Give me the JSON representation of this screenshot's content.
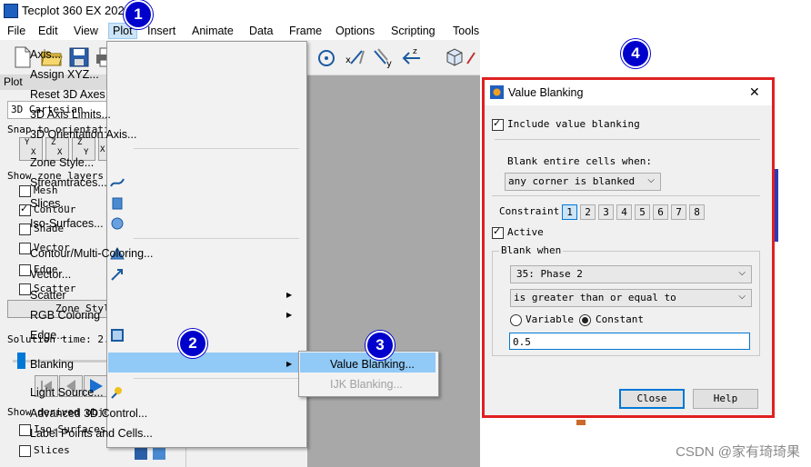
{
  "app": {
    "title": "Tecplot 360 EX 202"
  },
  "menubar": [
    "File",
    "Edit",
    "View",
    "Plot",
    "Insert",
    "Animate",
    "Data",
    "Frame",
    "Options",
    "Scripting",
    "Tools"
  ],
  "sidebar": {
    "header": "Plot",
    "plot_type": "3D Cartesian",
    "snap_label": "Snap to orientation",
    "snap_buttons": [
      {
        "top": "Y",
        "bottom": "X"
      },
      {
        "top": "Z",
        "bottom": "X"
      },
      {
        "top": "Z",
        "bottom": "Y"
      },
      {
        "top": "X",
        "bottom": ""
      }
    ],
    "zone_layers_label": "Show zone layers",
    "layers": [
      {
        "label": "Mesh",
        "checked": false
      },
      {
        "label": "Contour",
        "checked": true
      },
      {
        "label": "Shade",
        "checked": false
      },
      {
        "label": "Vector",
        "checked": false
      },
      {
        "label": "Edge",
        "checked": false
      },
      {
        "label": "Scatter",
        "checked": false
      }
    ],
    "zone_style_button": "Zone Styl",
    "solution_time": "Solution time: 2.00",
    "derived_label": "Show derived objec",
    "derived": [
      {
        "label": "Iso-Surfaces",
        "checked": false
      },
      {
        "label": "Slices",
        "checked": false
      }
    ]
  },
  "plot_menu": {
    "items": [
      {
        "label": "Axis..."
      },
      {
        "label": "Assign XYZ..."
      },
      {
        "label": "Reset 3D Axes"
      },
      {
        "label": "3D Axis Limits..."
      },
      {
        "label": "3D Orientation Axis..."
      },
      {
        "label": "Zone Style..."
      },
      {
        "label": "Streamtraces...",
        "icon": "streamtrace-icon"
      },
      {
        "label": "Slices...",
        "icon": "slice-icon"
      },
      {
        "label": "Iso-Surfaces...",
        "icon": "iso-surface-icon"
      },
      {
        "label": "Contour/Multi-Coloring...",
        "icon": "contour-icon"
      },
      {
        "label": "Vector...",
        "icon": "vector-icon"
      },
      {
        "label": "Scatter",
        "submenu": true
      },
      {
        "label": "RGB Coloring",
        "submenu": true
      },
      {
        "label": "Edge...",
        "icon": "edge-icon"
      },
      {
        "label": "Blanking",
        "submenu": true,
        "highlighted": true
      },
      {
        "label": "Light Source...",
        "icon": "light-source-icon"
      },
      {
        "label": "Advanced 3D Control..."
      },
      {
        "label": "Label Points and Cells..."
      }
    ]
  },
  "blanking_submenu": [
    {
      "label": "Value Blanking...",
      "enabled": true,
      "highlighted": true
    },
    {
      "label": "IJK Blanking...",
      "enabled": false
    }
  ],
  "badges": [
    "1",
    "2",
    "3",
    "4"
  ],
  "dialog": {
    "title": "Value Blanking",
    "close": "✕",
    "include_label": "Include value blanking",
    "include_checked": true,
    "blank_cells_label": "Blank entire cells when:",
    "blank_cells_value": "any corner is blanked",
    "constraint_label": "Constraint",
    "constraints": [
      "1",
      "2",
      "3",
      "4",
      "5",
      "6",
      "7",
      "8"
    ],
    "selected_constraint": "1",
    "active_label": "Active",
    "active_checked": true,
    "blank_when_label": "Blank when",
    "variable_value": "35: Phase 2",
    "operator_value": "is greater than or equal to",
    "radio_variable": "Variable",
    "radio_constant": "Constant",
    "selected_radio": "Constant",
    "constant_value": "0.5",
    "close_button": "Close",
    "help_button": "Help"
  },
  "watermark": "CSDN @家有琦琦果",
  "colors": {
    "highlight": "#91c9f7",
    "badge": "#0000cc",
    "frame": "#e02020",
    "viewport": "#a8a8a8"
  }
}
